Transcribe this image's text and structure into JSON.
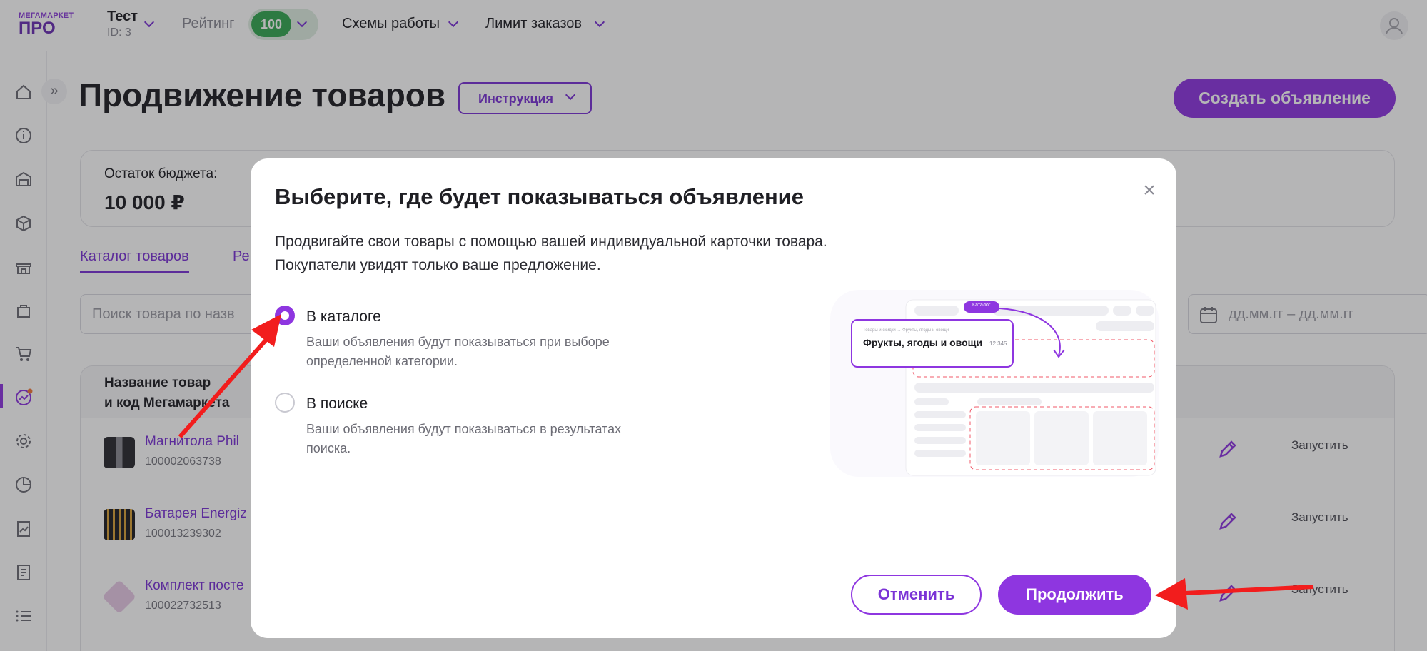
{
  "header": {
    "logo_small": "МЕГАМАРКЕТ",
    "logo_big": "ПРО",
    "store_name": "Тест",
    "store_id": "ID: 3",
    "rating_label": "Рейтинг",
    "rating_value": "100",
    "nav": [
      "Схемы работы",
      "Лимит заказов"
    ]
  },
  "sidebar": {
    "icons": [
      "home-icon",
      "info-icon",
      "warehouse-icon",
      "box-icon",
      "store-icon",
      "bag-icon",
      "cart-icon",
      "promotion-icon",
      "settings-icon",
      "pie-chart-icon",
      "report-icon",
      "document-icon",
      "list-icon"
    ],
    "collapse_label": "»"
  },
  "page": {
    "title": "Продвижение товаров",
    "instruction_button": "Инструкция",
    "create_button": "Создать объявление",
    "budget_label": "Остаток бюджета:",
    "budget_value": "10 000 ₽",
    "tabs": [
      "Каталог товаров",
      "Ре"
    ],
    "search_placeholder": "Поиск товара по назв",
    "date_placeholder": "дд.мм.гг – дд.мм.гг",
    "table_header": "Название товара и код Мегамаркета",
    "table_header_line1": "Название товар",
    "table_header_line2": "и код Мегамаркета",
    "rows": [
      {
        "name": "Магнитола Phil",
        "code": "100002063738",
        "action": "Запустить"
      },
      {
        "name": "Батарея Energiz",
        "code": "100013239302",
        "action": "Запустить"
      },
      {
        "name": "Комплект посте",
        "code": "100022732513",
        "action": "Запустить"
      }
    ]
  },
  "modal": {
    "title": "Выберите, где будет показываться объявление",
    "desc_line1": "Продвигайте свои товары с помощью вашей индивидуальной карточки товара.",
    "desc_line2": "Покупатели увидят только ваше предложение.",
    "options": [
      {
        "title": "В каталоге",
        "sub_line1": "Ваши объявления будут показываться при выборе",
        "sub_line2": "определенной категории.",
        "selected": true
      },
      {
        "title": "В поиске",
        "sub_line1": "Ваши объявления будут показываться в результатах",
        "sub_line2": "поиска.",
        "selected": false
      }
    ],
    "illustration": {
      "chip": "Каталог",
      "breadcrumb": "Товары и скидки → Фрукты, ягоды и овощи",
      "category": "Фрукты, ягоды и овощи",
      "count": "12 345"
    },
    "cancel_button": "Отменить",
    "continue_button": "Продолжить"
  },
  "colors": {
    "accent": "#8e36e0",
    "rating_green": "#35a853",
    "annotation_red": "#f21d1d"
  }
}
